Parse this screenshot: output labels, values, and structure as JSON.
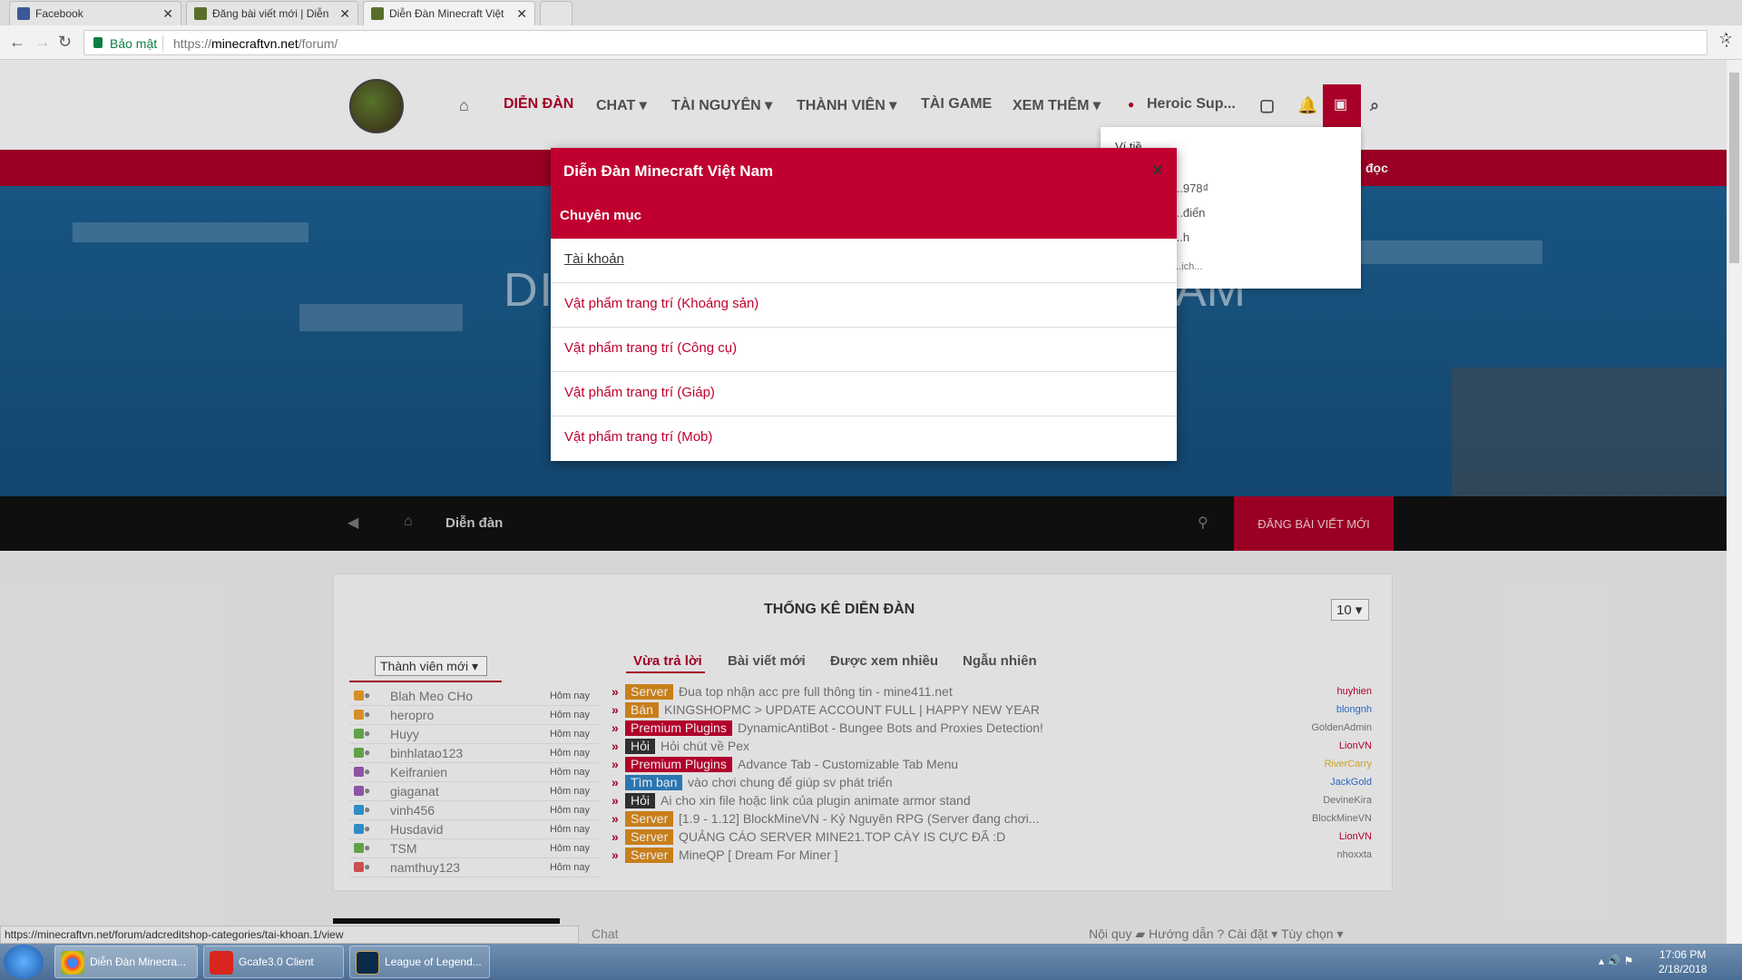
{
  "browser": {
    "tabs": [
      {
        "title": "Facebook"
      },
      {
        "title": "Đăng bài viết mới | Diễn"
      },
      {
        "title": "Diễn Đàn Minecraft Việt"
      }
    ],
    "secure_label": "Bảo mật",
    "url_prefix": "https://",
    "url_host": "minecraftvn.net",
    "url_path": "/forum/"
  },
  "nav": {
    "items": [
      "DIỄN ĐÀN",
      "CHAT ▾",
      "TÀI NGUYÊN ▾",
      "THÀNH VIÊN ▾",
      "TÀI GAME",
      "XEM THÊM ▾"
    ],
    "user": "Heroic Sup..."
  },
  "hero": {
    "text_left": "DI",
    "text_right": "AM"
  },
  "red_band": {
    "text_right": "đọc"
  },
  "breadcrumb": {
    "label": "Diễn đàn"
  },
  "post_button": "ĐĂNG BÀI VIẾT MỚI",
  "stats": {
    "title": "THỐNG KÊ DIỄN ĐÀN",
    "page_size": "10 ▾",
    "members_select": "Thành viên mới ▾",
    "tabs": [
      "Vừa trả lời",
      "Bài viết mới",
      "Được xem nhiều",
      "Ngẫu nhiên"
    ],
    "members": [
      {
        "name": "Blah Meo CHo",
        "time": "Hôm nay",
        "color": "#e89b2a"
      },
      {
        "name": "heropro",
        "time": "Hôm nay",
        "color": "#e89b2a"
      },
      {
        "name": "Huyy",
        "time": "Hôm nay",
        "color": "#6ab04c"
      },
      {
        "name": "binhlatao123",
        "time": "Hôm nay",
        "color": "#6ab04c"
      },
      {
        "name": "Keifranien",
        "time": "Hôm nay",
        "color": "#9b59b6"
      },
      {
        "name": "giaganat",
        "time": "Hôm nay",
        "color": "#9b59b6"
      },
      {
        "name": "vinh456",
        "time": "Hôm nay",
        "color": "#3498db"
      },
      {
        "name": "Husdavid",
        "time": "Hôm nay",
        "color": "#3498db"
      },
      {
        "name": "TSM",
        "time": "Hôm nay",
        "color": "#6ab04c"
      },
      {
        "name": "namthuy123",
        "time": "Hôm nay",
        "color": "#e05555"
      }
    ],
    "threads": [
      {
        "tag": "Server",
        "tag_color": "#d98a1e",
        "title": "Đua top nhận acc pre full thông tin - mine411.net",
        "author": "huyhien",
        "author_color": "#c0002f"
      },
      {
        "tag": "Bán",
        "tag_color": "#d98a1e",
        "title": "KINGSHOPMC > UPDATE ACCOUNT FULL | HAPPY NEW YEAR",
        "author": "blongnh",
        "author_color": "#2f6fd0"
      },
      {
        "tag": "Premium Plugins",
        "tag_color": "#c0002f",
        "title": "DynamicAntiBot - Bungee Bots and Proxies Detection!",
        "author": "GoldenAdmin",
        "author_color": "#777"
      },
      {
        "tag": "Hỏi",
        "tag_color": "#333",
        "title": "Hỏi chút về Pex",
        "author": "LionVN",
        "author_color": "#c0002f"
      },
      {
        "tag": "Premium Plugins",
        "tag_color": "#c0002f",
        "title": "Advance Tab - Customizable Tab Menu",
        "author": "RiverCarry",
        "author_color": "#e0b12a"
      },
      {
        "tag": "Tìm bạn",
        "tag_color": "#2f7fc0",
        "title": "vào chơi chung để giúp sv phát triển",
        "author": "JackGold",
        "author_color": "#2f6fd0"
      },
      {
        "tag": "Hỏi",
        "tag_color": "#333",
        "title": "Ai cho xin file hoặc link của plugin animate armor stand",
        "author": "DevineKira",
        "author_color": "#777"
      },
      {
        "tag": "Server",
        "tag_color": "#d98a1e",
        "title": "[1.9 - 1.12] BlockMineVN - Kỷ Nguyên RPG (Server đang chơi...",
        "author": "BlockMineVN",
        "author_color": "#777"
      },
      {
        "tag": "Server",
        "tag_color": "#d98a1e",
        "title": "QUẢNG CÁO SERVER MINE21.TOP CÀY IS CỰC ĐÃ :D",
        "author": "LionVN",
        "author_color": "#c0002f"
      },
      {
        "tag": "Server",
        "tag_color": "#d98a1e",
        "title": "MineQP [ Dream For Miner ]",
        "author": "nhoxxta",
        "author_color": "#777"
      }
    ]
  },
  "chat": {
    "label": "Chat",
    "options": "Nội quy ▰  Hướng dẫn ?  Cài đặt ▾  Tùy chọn ▾"
  },
  "status_url": "https://minecraftvn.net/forum/adcreditshop-categories/tai-khoan.1/view",
  "dropdown_partial": [
    "Ví tiề...",
    "...978₫",
    "...điển",
    "...h",
    "...ịch..."
  ],
  "dialog": {
    "title": "Diễn Đàn Minecraft Việt Nam",
    "subtitle": "Chuyên mục",
    "close": "×",
    "items": [
      "Tài khoản",
      "Vật phẩm trang trí (Khoáng sản)",
      "Vật phẩm trang trí (Công cụ)",
      "Vật phẩm trang trí (Giáp)",
      "Vật phẩm trang trí (Mob)"
    ]
  },
  "taskbar": {
    "items": [
      "Diễn Đàn Minecra...",
      "Gcafe3.0 Client",
      "League of Legend..."
    ],
    "time": "17:06 PM",
    "date": "2/18/2018"
  }
}
